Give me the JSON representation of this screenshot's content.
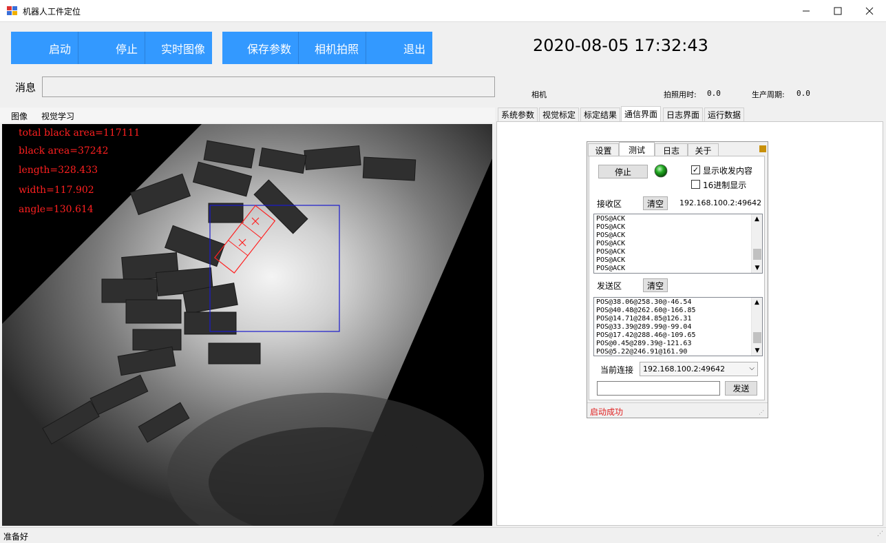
{
  "window": {
    "title": "机器人工件定位",
    "min_icon": "minimize-icon",
    "max_icon": "maximize-icon",
    "close_icon": "close-icon"
  },
  "toolbar": {
    "start": "启动",
    "stop": "停止",
    "live": "实时图像",
    "save": "保存参数",
    "capture": "相机拍照",
    "exit": "退出"
  },
  "datetime": "2020-08-05 17:32:43",
  "message": {
    "label": "消息",
    "value": ""
  },
  "info": {
    "camera_label": "相机",
    "shot_time_label": "拍照用时:",
    "shot_time_value": "0.0",
    "cycle_label": "生产周期:",
    "cycle_value": "0.0"
  },
  "left_menu": {
    "image": "图像",
    "vision": "视觉学习"
  },
  "overlay": {
    "total": "total black area=117111",
    "black": "black area=37242",
    "length": "length=328.433",
    "width": "width=117.902",
    "angle": "angle=130.614"
  },
  "tabs": [
    "系统参数",
    "视觉标定",
    "标定结果",
    "通信界面",
    "日志界面",
    "运行数据"
  ],
  "comm": {
    "tabs": [
      "设置",
      "测试",
      "日志",
      "关于"
    ],
    "stop": "停止",
    "show_content": "显示收发内容",
    "hex_display": "16进制显示",
    "recv_label": "接收区",
    "clear": "清空",
    "recv_addr": "192.168.100.2:49642",
    "recv_lines": [
      "POS@ACK",
      "POS@ACK",
      "POS@ACK",
      "POS@ACK",
      "POS@ACK",
      "POS@ACK",
      "POS@ACK"
    ],
    "send_label": "发送区",
    "send_lines": [
      "POS@38.06@258.30@-46.54",
      "POS@40.48@262.60@-166.85",
      "POS@14.71@284.85@126.31",
      "POS@33.39@289.99@-99.04",
      "POS@17.42@288.46@-109.65",
      "POS@0.45@289.39@-121.63",
      "POS@5.22@246.91@161.90"
    ],
    "current_label": "当前连接",
    "current_value": "192.168.100.2:49642",
    "send_input": "",
    "send_btn": "发送",
    "status": "启动成功",
    "status_color": "#e02020"
  },
  "statusbar": "准备好",
  "colors": {
    "button": "#3399ff",
    "overlay_text": "#ff2020",
    "roi": "#1a1acc",
    "led": "#22aa22"
  }
}
